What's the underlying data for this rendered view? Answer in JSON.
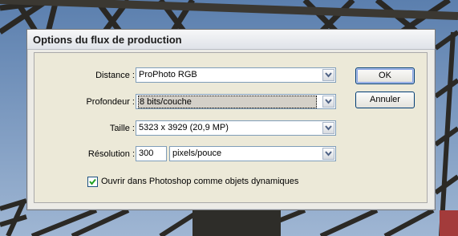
{
  "dialog": {
    "title": "Options du flux de production",
    "distance": {
      "label": "Distance :",
      "value": "ProPhoto RGB"
    },
    "profondeur": {
      "label": "Profondeur :",
      "value": "8 bits/couche"
    },
    "taille": {
      "label": "Taille :",
      "value": "5323 x 3929 (20,9 MP)"
    },
    "resolution": {
      "label": "Résolution :",
      "value": "300",
      "unit": "pixels/pouce"
    },
    "checkbox": {
      "label": "Ouvrir dans Photoshop comme objets dynamiques",
      "checked": true
    },
    "ok_label": "OK",
    "cancel_label": "Annuler"
  },
  "colors": {
    "button_border": "#003c74",
    "focus_fill": "#d4d0c8",
    "sky": "#7d9bc2"
  }
}
